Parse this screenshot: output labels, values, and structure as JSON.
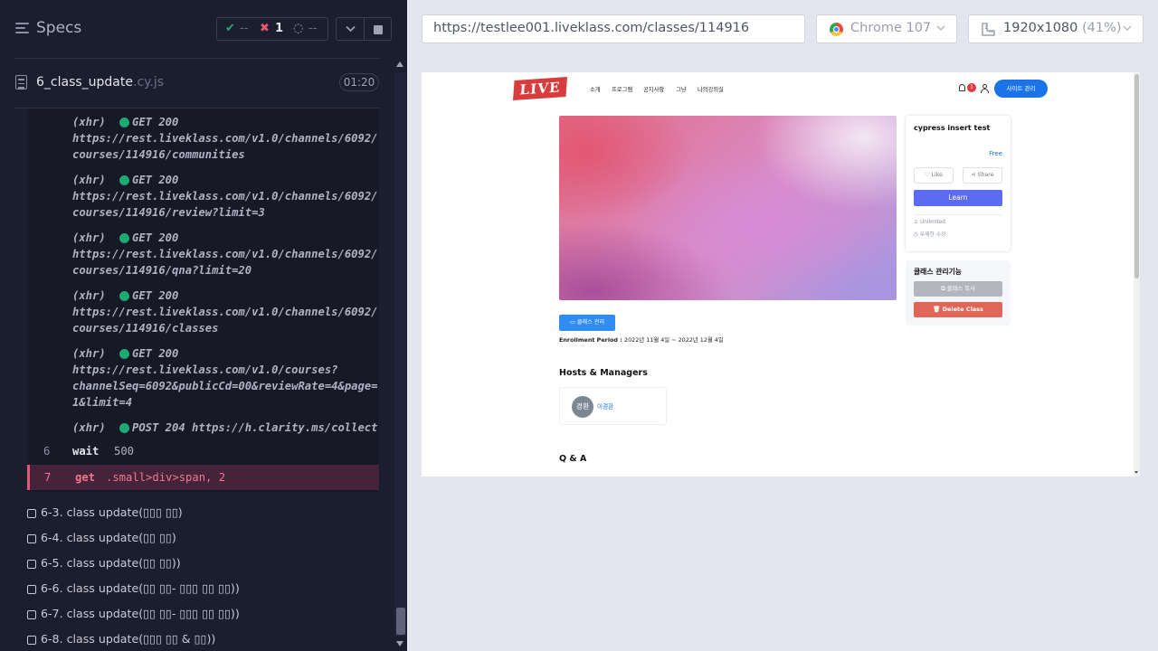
{
  "runner": {
    "specs_label": "Specs",
    "stats": {
      "passed": "--",
      "failed": "1",
      "pending": "--"
    },
    "file": {
      "name": "6_class_update",
      "ext": ".cy.js",
      "duration": "01:20"
    },
    "commands": [
      {
        "type": "xhr",
        "label": "(xhr)",
        "method": "GET 200",
        "url_line1": "https://rest.liveklass.com/v1.0/channels/6092/",
        "url_line2": "courses/114916/communities"
      },
      {
        "type": "xhr",
        "label": "(xhr)",
        "method": "GET 200",
        "url_line1": "https://rest.liveklass.com/v1.0/channels/6092/",
        "url_line2": "courses/114916/review?limit=3"
      },
      {
        "type": "xhr",
        "label": "(xhr)",
        "method": "GET 200",
        "url_line1": "https://rest.liveklass.com/v1.0/channels/6092/",
        "url_line2": "courses/114916/qna?limit=20"
      },
      {
        "type": "xhr",
        "label": "(xhr)",
        "method": "GET 200",
        "url_line1": "https://rest.liveklass.com/v1.0/channels/6092/",
        "url_line2": "courses/114916/classes"
      },
      {
        "type": "xhr",
        "label": "(xhr)",
        "method": "GET 200",
        "url_line1": "https://rest.liveklass.com/v1.0/courses?",
        "url_line2": "channelSeq=6092&publicCd=00&reviewRate=4&page=",
        "url_line3": "1&limit=4"
      },
      {
        "type": "xhr",
        "label": "(xhr)",
        "method": "POST 204 https://h.clarity.ms/collect"
      },
      {
        "type": "cmd",
        "num": "6",
        "name": "wait",
        "arg": "500"
      },
      {
        "type": "failed",
        "num": "7",
        "name": "get",
        "arg": ".small>div>span, 2"
      }
    ],
    "tests": [
      "6-3. class update(▯▯▯ ▯▯)",
      "6-4. class update(▯▯ ▯▯)",
      "6-5. class update(▯▯ ▯▯))",
      "6-6. class update(▯▯ ▯▯- ▯▯▯ ▯▯ ▯▯))",
      "6-7. class update(▯▯ ▯▯- ▯▯▯ ▯▯ ▯▯))",
      "6-8. class update(▯▯▯ ▯▯ & ▯▯))"
    ]
  },
  "preview": {
    "url": "https://testlee001.liveklass.com/classes/114916",
    "browser": "Chrome 107",
    "viewport": "1920x1080",
    "zoom": "(41%)"
  },
  "site": {
    "logo_text": "LIVE",
    "nav": [
      "소개",
      "프로그램",
      "공지사항",
      "그냥",
      "나의강의실"
    ],
    "notification_count": "1",
    "admin_button": "사이트 관리",
    "course": {
      "title": "cypress insert test",
      "price": "Free",
      "like": "Like",
      "share": "Share",
      "learn": "Learn",
      "meta": [
        "Unlimited",
        "무제한 수강"
      ]
    },
    "management": {
      "title": "클래스 관리기능",
      "copy": "클래스 복사",
      "delete": "Delete Class"
    },
    "class_admin_button": "클래스 관리",
    "enrollment_label": "Enrollment Period :",
    "enrollment_value": "2022년 11월 4일 ~ 2022년 12월 4일",
    "hosts_title": "Hosts & Managers",
    "host": {
      "avatar": "경환",
      "name": "이경환"
    },
    "qa_title": "Q & A"
  },
  "colors": {
    "runner_bg": "#1b1e2e",
    "pass": "#1fa971",
    "fail": "#e45770",
    "accent_blue": "#1a73e8",
    "learn_button": "#5c6cf2",
    "delete_button": "#e06757"
  }
}
